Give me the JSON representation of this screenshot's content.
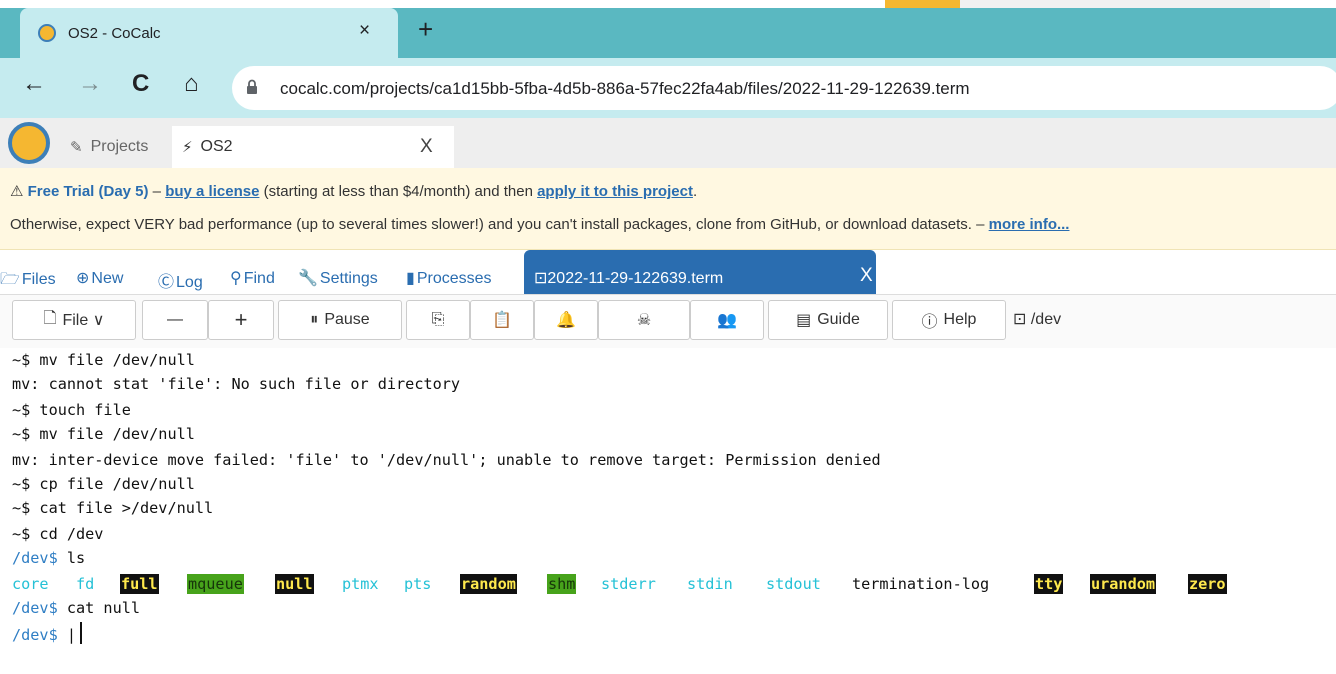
{
  "browser": {
    "tab_title": "OS2 - CoCalc",
    "tab_close": "×",
    "new_tab": "+",
    "url": "cocalc.com/projects/ca1d15bb-5fba-4d5b-886a-57fec22fa4ab/files/2022-11-29-122639.term",
    "back_icon": "←",
    "forward_icon": "→",
    "reload_icon": "C",
    "home_icon": "⌂"
  },
  "cocalc": {
    "projects_label": "Projects",
    "project_tab_label": "OS2",
    "project_tab_close": "X"
  },
  "banner": {
    "warn_icon": "⚠",
    "trial": "Free Trial (Day 5)",
    "dash1": " – ",
    "buy": "buy a license",
    "text1": " (starting at less than $4/month) and then ",
    "apply": "apply it to this project",
    "period": ".",
    "line2": "Otherwise, expect VERY bad performance (up to several times slower!) and you can't install packages, clone from GitHub, or download datasets. – ",
    "more": "more info..."
  },
  "actions": {
    "files": "Files",
    "new": "New",
    "log": "Log",
    "find": "Find",
    "settings": "Settings",
    "processes": "Processes",
    "file_tab": "2022-11-29-122639.term",
    "file_tab_close": "X"
  },
  "terminal_toolbar": {
    "file": "File ∨",
    "minus": "—",
    "plus": "+",
    "pause": "Pause",
    "guide": "Guide",
    "help": "Help",
    "path": "/dev"
  },
  "terminal": {
    "lines": [
      "~$ mv file /dev/null",
      "mv: cannot stat 'file': No such file or directory",
      "~$ touch file",
      "~$ mv file /dev/null",
      "mv: inter-device move failed: 'file' to '/dev/null'; unable to remove target: Permission denied",
      "~$ cp file /dev/null",
      "~$ cat file >/dev/null",
      "~$ cd /dev"
    ],
    "prompt_dev": "/dev$",
    "cmd_ls": " ls",
    "ls_items": [
      "core",
      "fd",
      "full",
      "mqueue",
      "null",
      "ptmx",
      "pts",
      "random",
      "shm",
      "stderr",
      "stdin",
      "stdout",
      "termination-log",
      "tty",
      "urandom",
      "zero"
    ],
    "cmd_cat": " cat null",
    "last_prompt": "/dev$",
    "last_after": " |"
  },
  "colors": {
    "accent": "#2a6db0",
    "chrome_bg": "#5ab8c1",
    "chrome_light": "#c5ebef",
    "banner_bg": "#fff8e1",
    "ls_cyan": "#25c1d6",
    "ls_highlight_yellow": "#ffe94d",
    "ls_highlight_green": "#47a31b"
  }
}
